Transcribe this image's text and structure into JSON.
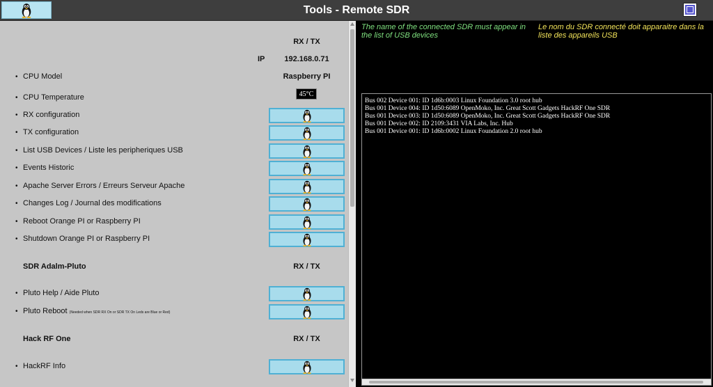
{
  "header": {
    "title": "Tools - Remote SDR"
  },
  "left": {
    "rxtx_heading": "RX / TX",
    "ip_label": "IP",
    "ip_value": "192.168.0.71",
    "cpu_model_label": "CPU Model",
    "cpu_model_value": "Raspberry PI",
    "cpu_temp_label": "CPU Temperature",
    "cpu_temp_value": "45°C",
    "items": [
      {
        "label": "RX configuration"
      },
      {
        "label": "TX configuration"
      },
      {
        "label": "List USB Devices / Liste les peripheriques USB"
      },
      {
        "label": "Events Historic"
      },
      {
        "label": "Apache Server Errors / Erreurs Serveur Apache"
      },
      {
        "label": "Changes Log / Journal des modifications"
      },
      {
        "label": "Reboot Orange PI or Raspberry PI"
      },
      {
        "label": "Shutdown Orange PI or Raspberry PI"
      }
    ],
    "pluto": {
      "title": "SDR Adalm-Pluto",
      "rxtx": "RX / TX",
      "help_label": "Pluto Help / Aide Pluto",
      "reboot_label": "Pluto Reboot",
      "reboot_note": "(Needed when SDR RX On or SDR TX On Leds are Blue or Red)"
    },
    "hackrf": {
      "title": "Hack RF One",
      "rxtx": "RX / TX",
      "info_label": "HackRF Info"
    }
  },
  "right": {
    "info_en": "The name of the connected SDR must appear in the list of USB devices",
    "info_fr": "Le nom du SDR connecté doit apparaitre dans la liste des appareils USB",
    "console_lines": [
      "Bus 002 Device 001: ID 1d6b:0003 Linux Foundation 3.0 root hub",
      "Bus 001 Device 004: ID 1d50:6089 OpenMoko, Inc. Great Scott Gadgets HackRF One SDR",
      "Bus 001 Device 003: ID 1d50:6089 OpenMoko, Inc. Great Scott Gadgets HackRF One SDR",
      "Bus 001 Device 002: ID 2109:3431 VIA Labs, Inc. Hub",
      "Bus 001 Device 001: ID 1d6b:0002 Linux Foundation 2.0 root hub"
    ]
  },
  "icons": {
    "logo": "tux-penguin-icon",
    "button": "tux-penguin-icon",
    "window": "window-square-icon"
  },
  "colors": {
    "button_bg": "#a8dcec",
    "button_border": "#4fb0d4",
    "panel_bg": "#c6c6c6",
    "info_en": "#7fe07f",
    "info_fr": "#f3e45a"
  }
}
